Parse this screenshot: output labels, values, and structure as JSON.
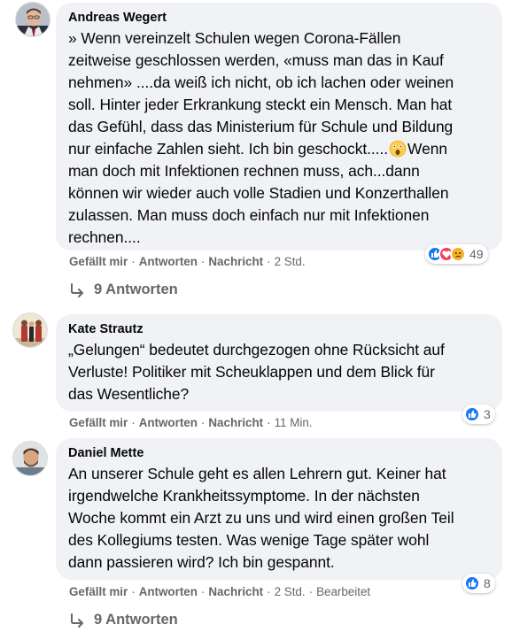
{
  "comments": [
    {
      "author": "Andreas Wegert",
      "lines": [
        "» Wenn vereinzelt Schulen wegen Corona-Fällen",
        "zeitweise geschlossen werden, «muss man das in Kauf",
        "nehmen» ....da weiß ich nicht, ob ich lachen oder weinen",
        "soll. Hinter jeder Erkrankung steckt ein Mensch. Man hat",
        "das Gefühl, dass das Ministerium für Schule und Bildung",
        "nur einfache Zahlen sieht. Ich bin geschockt.....",
        "man doch mit Infektionen rechnen muss, ach...dann",
        "können wir wieder auch volle Stadien und Konzerthallen",
        "zulassen. Man muss doch einfach nur mit Infektionen",
        "rechnen...."
      ],
      "line6_tail": "Wenn",
      "actions": {
        "like": "Gefällt mir",
        "reply": "Antworten",
        "message": "Nachricht",
        "time": "2 Std."
      },
      "reactions": {
        "count": "49",
        "icons": [
          "like-icon",
          "love-icon",
          "sad-icon"
        ]
      },
      "replies": "9 Antworten"
    },
    {
      "author": "Kate Strautz",
      "lines": [
        "„Gelungen“ bedeutet durchgezogen ohne Rücksicht auf",
        "Verluste! Politiker mit Scheuklappen und dem Blick für",
        "das Wesentliche?"
      ],
      "actions": {
        "like": "Gefällt mir",
        "reply": "Antworten",
        "message": "Nachricht",
        "time": "11 Min."
      },
      "reactions": {
        "count": "3",
        "icons": [
          "like-icon"
        ]
      }
    },
    {
      "author": "Daniel Mette",
      "lines": [
        "An unserer Schule geht es allen Lehrern gut. Keiner hat",
        "irgendwelche Krankheitssymptome. In der nächsten",
        "Woche kommt ein Arzt zu uns und wird einen großen Teil",
        "des Kollegiums testen. Was wenige Tage später wohl",
        "dann passieren wird? Ich bin gespannt."
      ],
      "actions": {
        "like": "Gefällt mir",
        "reply": "Antworten",
        "message": "Nachricht",
        "time": "2 Std.",
        "edited": "Bearbeitet"
      },
      "reactions": {
        "count": "8",
        "icons": [
          "like-icon"
        ]
      },
      "replies": "9 Antworten"
    }
  ],
  "colors": {
    "bubble": "#f0f2f5",
    "meta": "#65676b",
    "like": "#1877f2",
    "love": "#f33e58",
    "sad": "#f7b125"
  }
}
